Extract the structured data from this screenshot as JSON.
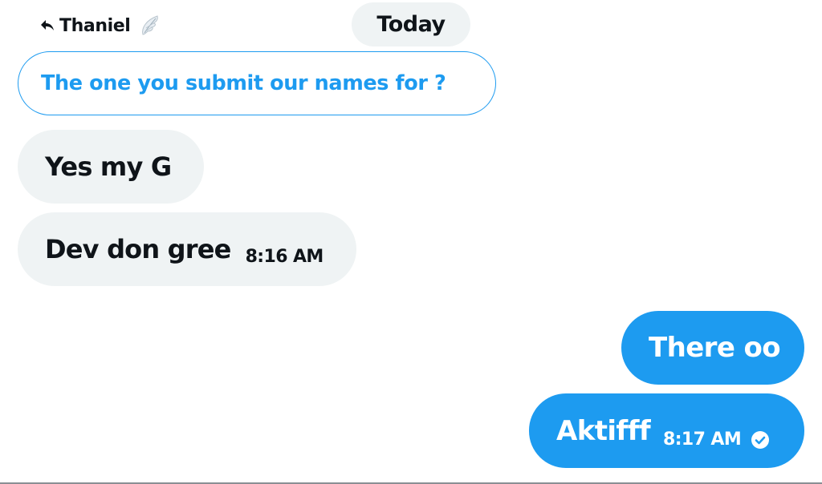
{
  "reply_header": {
    "arrow_icon": "reply-arrow-icon",
    "name": "Thaniel",
    "emoji_icon": "wing-icon"
  },
  "date_separator": "Today",
  "quoted_message": "The one you submit our names for ?",
  "messages": [
    {
      "direction": "incoming",
      "text": "Yes my G",
      "time": ""
    },
    {
      "direction": "incoming",
      "text": "Dev don gree",
      "time": "8:16 AM"
    },
    {
      "direction": "outgoing",
      "text": "There oo",
      "time": ""
    },
    {
      "direction": "outgoing",
      "text": "Aktifff",
      "time": "8:17 AM",
      "status_icon": "read-check-icon"
    }
  ],
  "colors": {
    "accent": "#1d9bf0",
    "incoming_bubble": "#eff3f4",
    "text": "#0f1419"
  }
}
